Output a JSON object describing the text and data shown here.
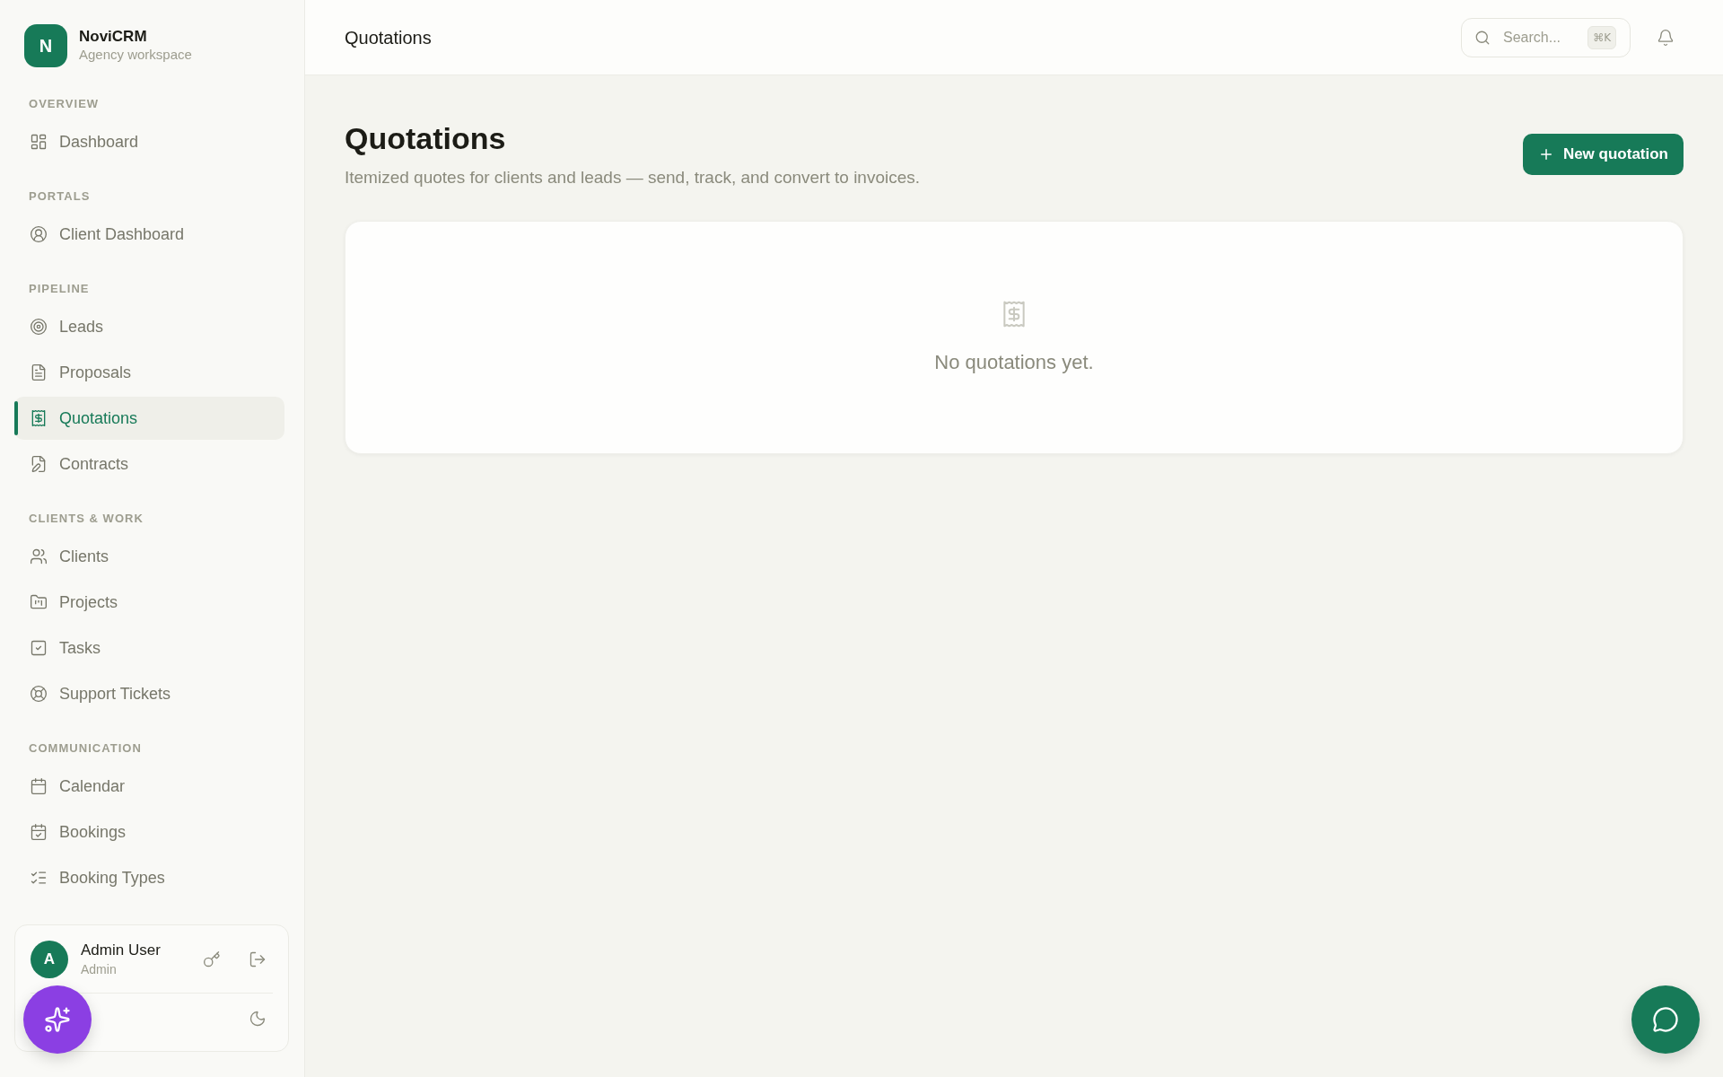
{
  "brand": {
    "logo_letter": "N",
    "name": "NoviCRM",
    "workspace": "Agency workspace"
  },
  "sidebar": {
    "sections": [
      {
        "title": "OVERVIEW",
        "items": [
          {
            "label": "Dashboard",
            "selected": false
          }
        ]
      },
      {
        "title": "PORTALS",
        "items": [
          {
            "label": "Client Dashboard",
            "selected": false
          }
        ]
      },
      {
        "title": "PIPELINE",
        "items": [
          {
            "label": "Leads",
            "selected": false
          },
          {
            "label": "Proposals",
            "selected": false
          },
          {
            "label": "Quotations",
            "selected": true
          },
          {
            "label": "Contracts",
            "selected": false
          }
        ]
      },
      {
        "title": "CLIENTS & WORK",
        "items": [
          {
            "label": "Clients",
            "selected": false
          },
          {
            "label": "Projects",
            "selected": false
          },
          {
            "label": "Tasks",
            "selected": false
          },
          {
            "label": "Support Tickets",
            "selected": false
          }
        ]
      },
      {
        "title": "COMMUNICATION",
        "items": [
          {
            "label": "Calendar",
            "selected": false
          },
          {
            "label": "Bookings",
            "selected": false
          },
          {
            "label": "Booking Types",
            "selected": false
          }
        ]
      }
    ]
  },
  "user": {
    "avatar_letter": "A",
    "name": "Admin User",
    "role": "Admin"
  },
  "topbar": {
    "title": "Quotations",
    "search": {
      "placeholder": "Search...",
      "shortcut": "⌘K"
    }
  },
  "page": {
    "title": "Quotations",
    "subtitle": "Itemized quotes for clients and leads — send, track, and convert to invoices.",
    "action": "New quotation"
  },
  "empty_state": {
    "message": "No quotations yet."
  }
}
